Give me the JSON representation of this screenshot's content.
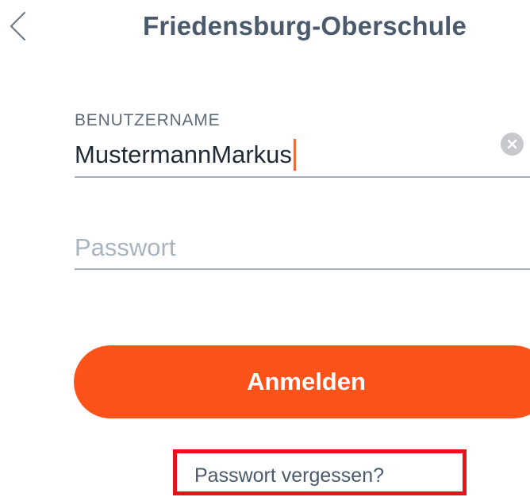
{
  "header": {
    "title": "Friedensburg-Oberschule",
    "back_icon": "chevron-left-icon"
  },
  "login_form": {
    "username": {
      "label": "BENUTZERNAME",
      "value": "MustermannMarkus",
      "clear_icon": "clear-circle-icon"
    },
    "password": {
      "placeholder": "Passwort",
      "value": ""
    },
    "submit_label": "Anmelden",
    "forgot_password_label": "Passwort vergessen?"
  },
  "colors": {
    "accent": "#fd5219",
    "caret": "#f26a3c",
    "title_text": "#4a5a6c",
    "highlight_box": "#e3151b"
  }
}
